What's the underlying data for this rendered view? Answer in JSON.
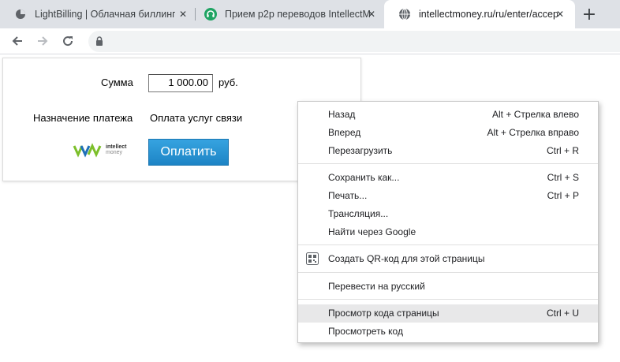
{
  "tabs": [
    {
      "title": "LightBilling | Облачная биллинго",
      "favicon": "lightbilling-pie-icon"
    },
    {
      "title": "Прием p2p переводов IntellectM",
      "favicon": "green-headset-icon"
    },
    {
      "title": "intellectmoney.ru/ru/enter/accep",
      "favicon": "globe-icon"
    }
  ],
  "close_glyph": "✕",
  "newtab_glyph": "+",
  "toolbar": {
    "back": "back-arrow-icon",
    "forward": "forward-arrow-icon",
    "reload": "reload-icon",
    "security": "lock-icon"
  },
  "page": {
    "sum_label": "Сумма",
    "amount_value": "1 000.00",
    "currency": "руб.",
    "purpose_label": "Назначение платежа",
    "purpose_value": "Оплата услуг связи",
    "logo_line1": "intellect",
    "logo_line2": "money",
    "pay_button": "Оплатить",
    "colors": {
      "pay_button": "#2a93d5",
      "logo_green": "#7cbf2a",
      "logo_blue": "#1e6fb8"
    }
  },
  "context_menu": {
    "items": [
      {
        "label": "Назад",
        "shortcut": "Alt + Стрелка влево"
      },
      {
        "label": "Вперед",
        "shortcut": "Alt + Стрелка вправо"
      },
      {
        "label": "Перезагрузить",
        "shortcut": "Ctrl + R"
      },
      {
        "label": "Сохранить как...",
        "shortcut": "Ctrl + S"
      },
      {
        "label": "Печать...",
        "shortcut": "Ctrl + P"
      },
      {
        "label": "Трансляция...",
        "shortcut": ""
      },
      {
        "label": "Найти через Google",
        "shortcut": ""
      },
      {
        "label": "Создать QR-код для этой страницы",
        "shortcut": "",
        "icon": "qr-code-icon"
      },
      {
        "label": "Перевести на русский",
        "shortcut": ""
      },
      {
        "label": "Просмотр кода страницы",
        "shortcut": "Ctrl + U",
        "highlighted": true
      },
      {
        "label": "Просмотреть код",
        "shortcut": ""
      }
    ]
  }
}
